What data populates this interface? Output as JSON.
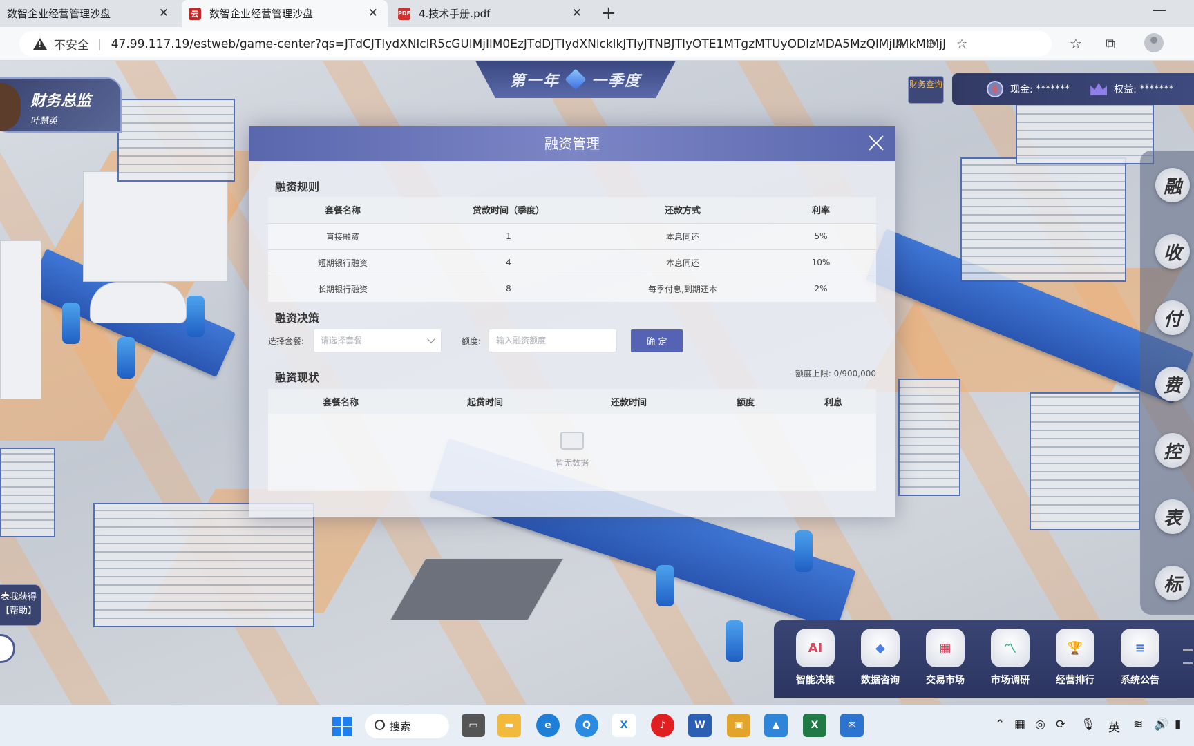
{
  "browser": {
    "tabs": [
      {
        "title": "数智企业经营管理沙盘",
        "active": false
      },
      {
        "title": "数智企业经营管理沙盘",
        "active": true
      },
      {
        "title": "4.技术手册.pdf",
        "active": false
      }
    ],
    "insecure_label": "不安全",
    "url": "47.99.117.19/estweb/game-center?qs=JTdCJTIydXNlclR5cGUlMjIlM0EzJTdDJTIydXNlcklkJTIyJTNBJTIyOTE1MTgzMTUyODIzMDA5MzQlMjIlMkMlMjJ1c2VyQ29..."
  },
  "game": {
    "season": {
      "year": "第一年",
      "quarter": "一季度"
    },
    "role": {
      "title": "财务总监",
      "name": "叶慧英"
    },
    "finance_query": "财务查询",
    "cash_label": "现金:",
    "cash_value": "*******",
    "equity_label": "权益:",
    "equity_value": "*******",
    "side_menu": [
      "融",
      "收",
      "付",
      "费",
      "控",
      "表",
      "标"
    ],
    "help_text_1": "表我获得",
    "help_text_2": "【帮助】",
    "dock": [
      {
        "label": "智能决策",
        "icon": "ai-icon",
        "glyph": "AI",
        "color": "#e0455e"
      },
      {
        "label": "数据咨询",
        "icon": "data-icon",
        "glyph": "◆",
        "color": "#4a7ee8"
      },
      {
        "label": "交易市场",
        "icon": "market-icon",
        "glyph": "▦",
        "color": "#e0455e"
      },
      {
        "label": "市场调研",
        "icon": "research-icon",
        "glyph": "〽",
        "color": "#2fb27c"
      },
      {
        "label": "经营排行",
        "icon": "trophy-icon",
        "glyph": "🏆",
        "color": "#e9a21a"
      },
      {
        "label": "系统公告",
        "icon": "notice-icon",
        "glyph": "≡",
        "color": "#3b76ea"
      }
    ]
  },
  "dialog": {
    "title": "融资管理",
    "rules_title": "融资规则",
    "rules_headers": [
      "套餐名称",
      "贷款时间（季度）",
      "还款方式",
      "利率"
    ],
    "rules_rows": [
      [
        "直接融资",
        "1",
        "本息同还",
        "5%"
      ],
      [
        "短期银行融资",
        "4",
        "本息同还",
        "10%"
      ],
      [
        "长期银行融资",
        "8",
        "每季付息,到期还本",
        "2%"
      ]
    ],
    "decision_title": "融资决策",
    "select_label": "选择套餐:",
    "select_placeholder": "请选择套餐",
    "amount_label": "额度:",
    "amount_placeholder": "输入融资额度",
    "confirm_label": "确 定",
    "status_title": "融资现状",
    "limit_text": "额度上限: 0/900,000",
    "status_headers": [
      "套餐名称",
      "起贷时间",
      "还款时间",
      "额度",
      "利息"
    ],
    "empty_text": "暂无数据"
  },
  "taskbar": {
    "search_label": "搜索",
    "ime": "英"
  }
}
